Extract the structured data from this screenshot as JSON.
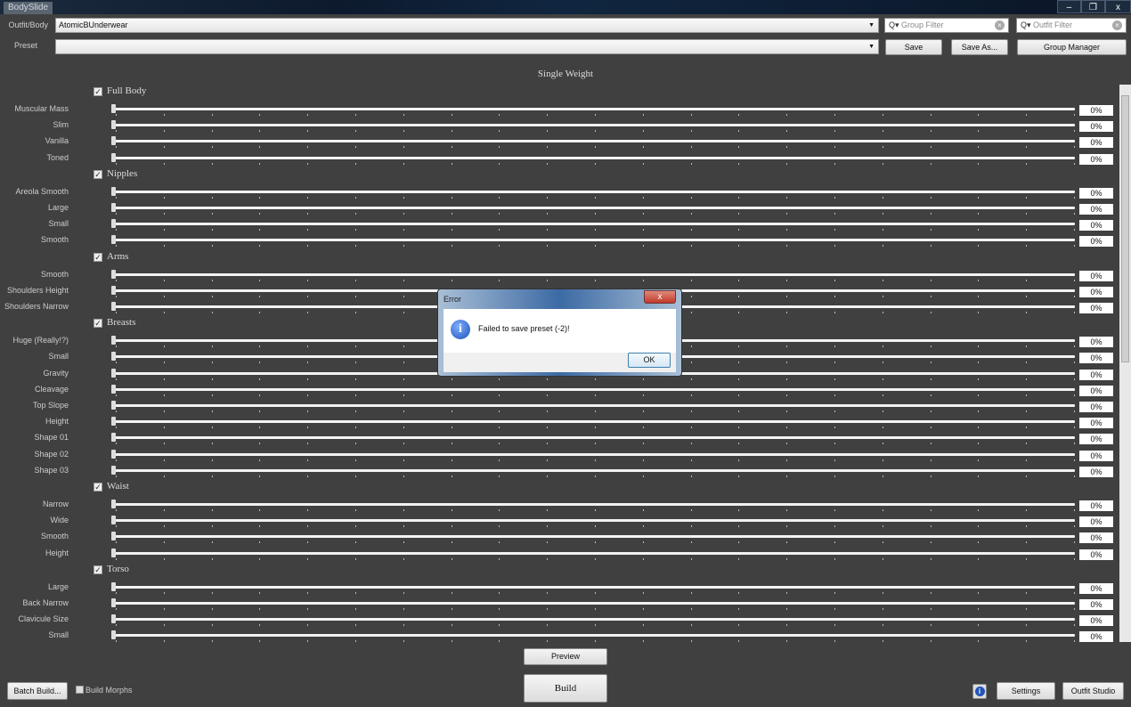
{
  "window": {
    "title": "BodySlide",
    "controls": {
      "minimize": "–",
      "restore": "❐",
      "close": "x"
    }
  },
  "outfit": {
    "label": "Outfit/Body",
    "value": "AtomicBUnderwear"
  },
  "preset": {
    "label": "Preset",
    "value": ""
  },
  "filters": {
    "group_placeholder": "Group Filter",
    "outfit_placeholder": "Outfit Filter"
  },
  "buttons": {
    "save": "Save",
    "save_as": "Save As...",
    "group_manager": "Group Manager",
    "preview": "Preview",
    "build": "Build",
    "batch_build": "Batch Build...",
    "settings": "Settings",
    "outfit_studio": "Outfit Studio"
  },
  "build_morphs": {
    "label": "Build Morphs",
    "checked": false
  },
  "weight_mode": "Single Weight",
  "groups": [
    {
      "name": "Full Body",
      "checked": true,
      "sliders": [
        {
          "name": "Muscular Mass",
          "value": "0%"
        },
        {
          "name": "Slim",
          "value": "0%"
        },
        {
          "name": "Vanilla",
          "value": "0%"
        },
        {
          "name": "Toned",
          "value": "0%"
        }
      ]
    },
    {
      "name": "Nipples",
      "checked": true,
      "sliders": [
        {
          "name": "Areola Smooth",
          "value": "0%"
        },
        {
          "name": "Large",
          "value": "0%"
        },
        {
          "name": "Small",
          "value": "0%"
        },
        {
          "name": "Smooth",
          "value": "0%"
        }
      ]
    },
    {
      "name": "Arms",
      "checked": true,
      "sliders": [
        {
          "name": "Smooth",
          "value": "0%"
        },
        {
          "name": "Shoulders Height",
          "value": "0%"
        },
        {
          "name": "Shoulders Narrow",
          "value": "0%"
        }
      ]
    },
    {
      "name": "Breasts",
      "checked": true,
      "sliders": [
        {
          "name": "Huge (Really!?)",
          "value": "0%"
        },
        {
          "name": "Small",
          "value": "0%"
        },
        {
          "name": "Gravity",
          "value": "0%"
        },
        {
          "name": "Cleavage",
          "value": "0%"
        },
        {
          "name": "Top Slope",
          "value": "0%"
        },
        {
          "name": "Height",
          "value": "0%"
        },
        {
          "name": "Shape 01",
          "value": "0%"
        },
        {
          "name": "Shape 02",
          "value": "0%"
        },
        {
          "name": "Shape 03",
          "value": "0%"
        }
      ]
    },
    {
      "name": "Waist",
      "checked": true,
      "sliders": [
        {
          "name": "Narrow",
          "value": "0%"
        },
        {
          "name": "Wide",
          "value": "0%"
        },
        {
          "name": "Smooth",
          "value": "0%"
        },
        {
          "name": "Height",
          "value": "0%"
        }
      ]
    },
    {
      "name": "Torso",
      "checked": true,
      "sliders": [
        {
          "name": "Large",
          "value": "0%"
        },
        {
          "name": "Back Narrow",
          "value": "0%"
        },
        {
          "name": "Clavicule Size",
          "value": "0%"
        },
        {
          "name": "Small",
          "value": "0%"
        }
      ]
    }
  ],
  "dialog": {
    "title": "Error",
    "message": "Failed to save preset (-2)!",
    "ok": "OK",
    "close": "x",
    "icon": "info-icon"
  }
}
